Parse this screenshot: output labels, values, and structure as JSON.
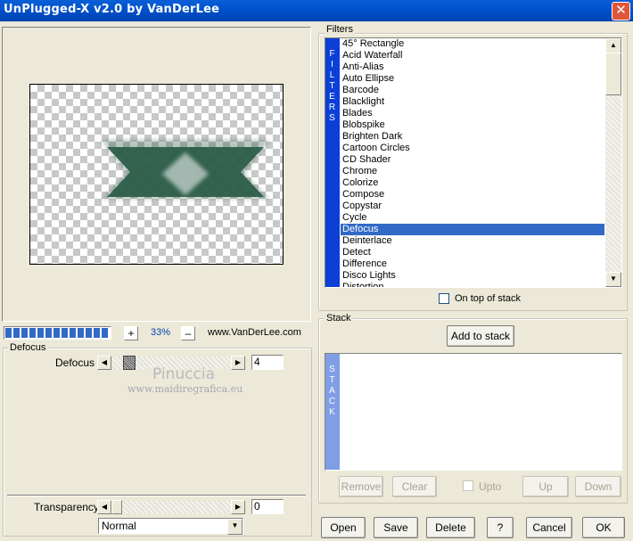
{
  "window": {
    "title": "UnPlugged-X v2.0 by VanDerLee"
  },
  "preview": {
    "zoom": "33%",
    "zoom_in": "+",
    "zoom_out": "–",
    "website": "www.VanDerLee.com",
    "progress_blocks": 13
  },
  "filters_group": {
    "label": "Filters",
    "side_letters": [
      "F",
      "I",
      "L",
      "T",
      "E",
      "R",
      "S"
    ],
    "items": [
      "45° Rectangle",
      "Acid Waterfall",
      "Anti-Alias",
      "Auto Ellipse",
      "Barcode",
      "Blacklight",
      "Blades",
      "Blobspike",
      "Brighten Dark",
      "Cartoon Circles",
      "CD Shader",
      "Chrome",
      "Colorize",
      "Compose",
      "Copystar",
      "Cycle",
      "Defocus",
      "Deinterlace",
      "Detect",
      "Difference",
      "Disco Lights",
      "Distortion"
    ],
    "selected": "Defocus",
    "on_top_label": "On top of stack"
  },
  "stack_group": {
    "label": "Stack",
    "add_button": "Add to stack",
    "side_letters": [
      "S",
      "T",
      "A",
      "C",
      "K"
    ],
    "remove": "Remove",
    "clear": "Clear",
    "upto": "Upto",
    "up": "Up",
    "down": "Down"
  },
  "params": {
    "group_label": "Defocus",
    "defocus_label": "Defocus",
    "defocus_value": "4",
    "watermark_name": "Pinuccia",
    "watermark_url": "www.maidiregrafica.eu",
    "transparency_label": "Transparency",
    "transparency_value": "0",
    "blend_mode": "Normal"
  },
  "footer": {
    "open": "Open",
    "save": "Save",
    "delete": "Delete",
    "help": "?",
    "cancel": "Cancel",
    "ok": "OK"
  },
  "colors": {
    "accent": "#316ac5",
    "shape_green": "#2d5e4a",
    "title_blue": "#0054e3"
  }
}
